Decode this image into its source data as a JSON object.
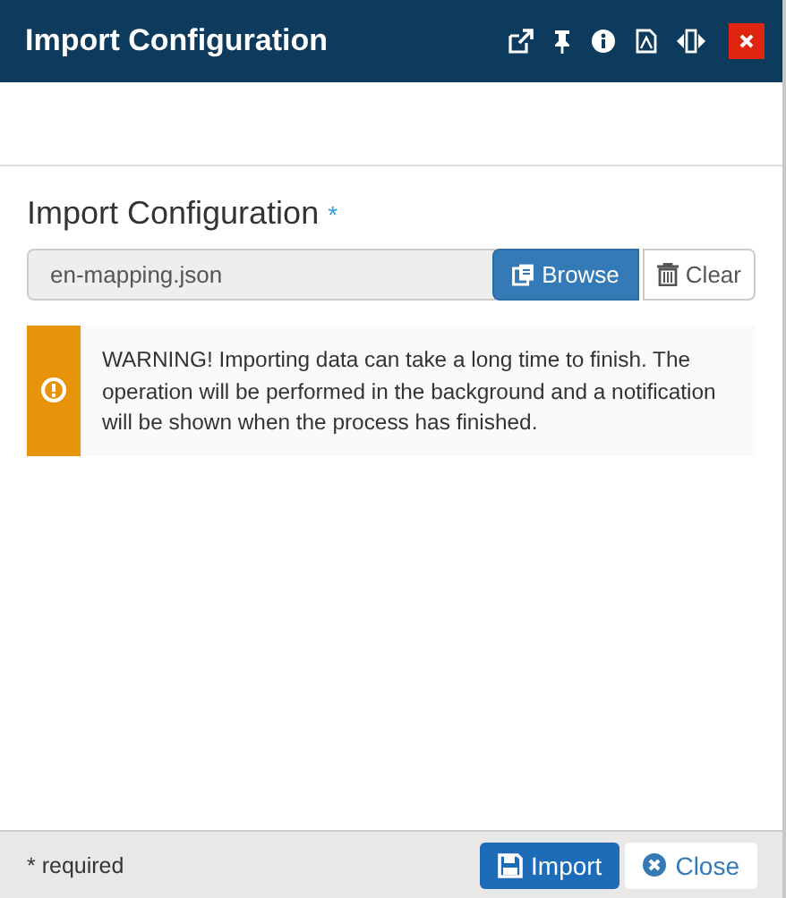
{
  "window": {
    "title": "Import Configuration"
  },
  "field": {
    "label": "Import Configuration",
    "required_mark": "*",
    "value": "en-mapping.json"
  },
  "field_buttons": [
    {
      "kind": "browse",
      "label": "Browse"
    },
    {
      "kind": "clear",
      "label": "Clear"
    }
  ],
  "warning": {
    "text": "WARNING! Importing data can take a long time to finish. The operation will be performed in the background and a notification will be shown when the process has finished."
  },
  "footer": {
    "note": "* required",
    "buttons": [
      {
        "kind": "import",
        "label": "Import"
      },
      {
        "kind": "close",
        "label": "Close"
      }
    ]
  }
}
